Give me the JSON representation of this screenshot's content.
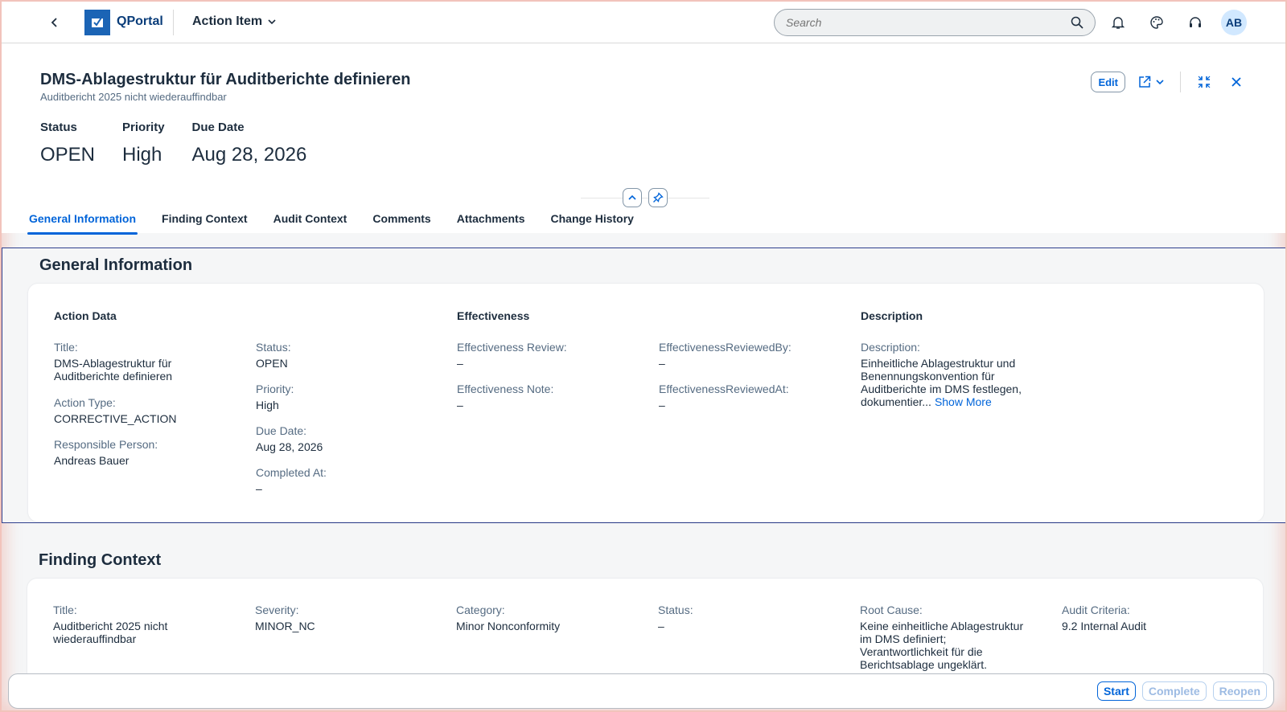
{
  "shell": {
    "product": "QPortal",
    "app_title": "Action Item",
    "search_placeholder": "Search",
    "avatar_initials": "AB"
  },
  "header": {
    "title": "DMS-Ablagestruktur für Auditberichte definieren",
    "subtitle": "Auditbericht 2025 nicht wiederauffindbar",
    "edit_label": "Edit",
    "kpis": [
      {
        "label": "Status",
        "value": "OPEN"
      },
      {
        "label": "Priority",
        "value": "High"
      },
      {
        "label": "Due Date",
        "value": "Aug 28, 2026"
      }
    ]
  },
  "tabs": [
    {
      "label": "General Information",
      "active": true
    },
    {
      "label": "Finding Context",
      "active": false
    },
    {
      "label": "Audit Context",
      "active": false
    },
    {
      "label": "Comments",
      "active": false
    },
    {
      "label": "Attachments",
      "active": false
    },
    {
      "label": "Change History",
      "active": false
    }
  ],
  "general_information": {
    "section_title": "General Information",
    "action_data": {
      "title": "Action Data",
      "fields": [
        {
          "label": "Title:",
          "value": "DMS-Ablagestruktur für Auditberichte definieren"
        },
        {
          "label": "Action Type:",
          "value": "CORRECTIVE_ACTION"
        },
        {
          "label": "Responsible Person:",
          "value": "Andreas Bauer"
        },
        {
          "label": "Status:",
          "value": "OPEN"
        },
        {
          "label": "Priority:",
          "value": "High"
        },
        {
          "label": "Due Date:",
          "value": "Aug 28, 2026"
        },
        {
          "label": "Completed At:",
          "value": "–"
        }
      ]
    },
    "effectiveness": {
      "title": "Effectiveness",
      "fields": [
        {
          "label": "Effectiveness Review:",
          "value": "–"
        },
        {
          "label": "Effectiveness Note:",
          "value": "–"
        },
        {
          "label": "EffectivenessReviewedBy:",
          "value": "–"
        },
        {
          "label": "EffectivenessReviewedAt:",
          "value": "–"
        }
      ]
    },
    "description": {
      "title": "Description",
      "label": "Description:",
      "value": "Einheitliche Ablagestruktur und Benennungskonvention für Auditberichte im DMS festlegen, dokumentier...",
      "show_more": "Show More"
    }
  },
  "finding_context": {
    "section_title": "Finding Context",
    "fields": [
      {
        "label": "Title:",
        "value": "Auditbericht 2025 nicht wiederauffindbar"
      },
      {
        "label": "Severity:",
        "value": "MINOR_NC"
      },
      {
        "label": "Category:",
        "value": "Minor Nonconformity"
      },
      {
        "label": "Status:",
        "value": "–"
      },
      {
        "label": "Root Cause:",
        "value": "Keine einheitliche Ablagestruktur im DMS definiert; Verantwortlichkeit für die Berichtsablage ungeklärt."
      },
      {
        "label": "Audit Criteria:",
        "value": "9.2 Internal Audit"
      }
    ]
  },
  "footer": {
    "start": "Start",
    "complete": "Complete",
    "reopen": "Reopen"
  },
  "colors": {
    "accent": "#0064d9",
    "brand": "#1b64b5",
    "section_outline": "#2e3f8d"
  }
}
